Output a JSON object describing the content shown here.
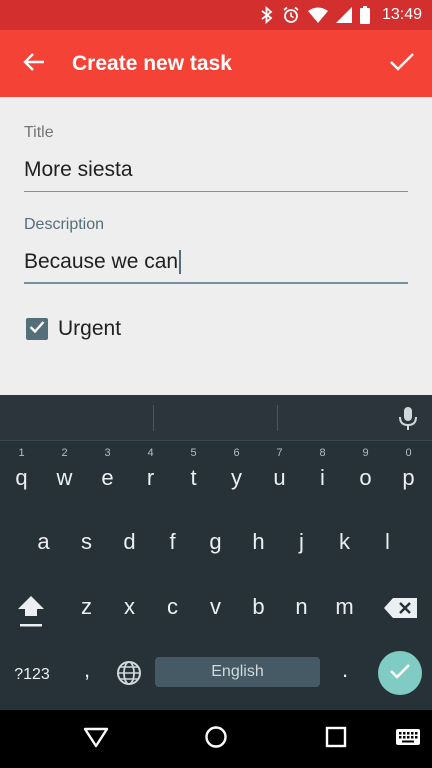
{
  "status_bar": {
    "time": "13:49",
    "icons": [
      "bluetooth-icon",
      "alarm-icon",
      "wifi-icon",
      "cellular-signal-icon",
      "battery-icon"
    ],
    "background": "#d32f2f"
  },
  "app_bar": {
    "title": "Create new task",
    "back_icon": "arrow-back-icon",
    "done_icon": "check-icon",
    "background": "#f44336"
  },
  "form": {
    "title_label": "Title",
    "title_value": "More siesta",
    "description_label": "Description",
    "description_value": "Because we can",
    "urgent_label": "Urgent",
    "urgent_checked": true,
    "accent": "#546e7a"
  },
  "keyboard": {
    "row1": [
      {
        "key": "q",
        "hint": "1"
      },
      {
        "key": "w",
        "hint": "2"
      },
      {
        "key": "e",
        "hint": "3"
      },
      {
        "key": "r",
        "hint": "4"
      },
      {
        "key": "t",
        "hint": "5"
      },
      {
        "key": "y",
        "hint": "6"
      },
      {
        "key": "u",
        "hint": "7"
      },
      {
        "key": "i",
        "hint": "8"
      },
      {
        "key": "o",
        "hint": "9"
      },
      {
        "key": "p",
        "hint": "0"
      }
    ],
    "row2": [
      "a",
      "s",
      "d",
      "f",
      "g",
      "h",
      "j",
      "k",
      "l"
    ],
    "row3": [
      "z",
      "x",
      "c",
      "v",
      "b",
      "n",
      "m"
    ],
    "symbols_label": "?123",
    "comma": ",",
    "space_label": "English",
    "period": ".",
    "background": "#263238",
    "enter_color": "#80cbc4"
  },
  "nav_bar": {
    "icons": [
      "back-triangle-icon",
      "home-circle-icon",
      "recents-square-icon",
      "keyboard-icon"
    ]
  }
}
